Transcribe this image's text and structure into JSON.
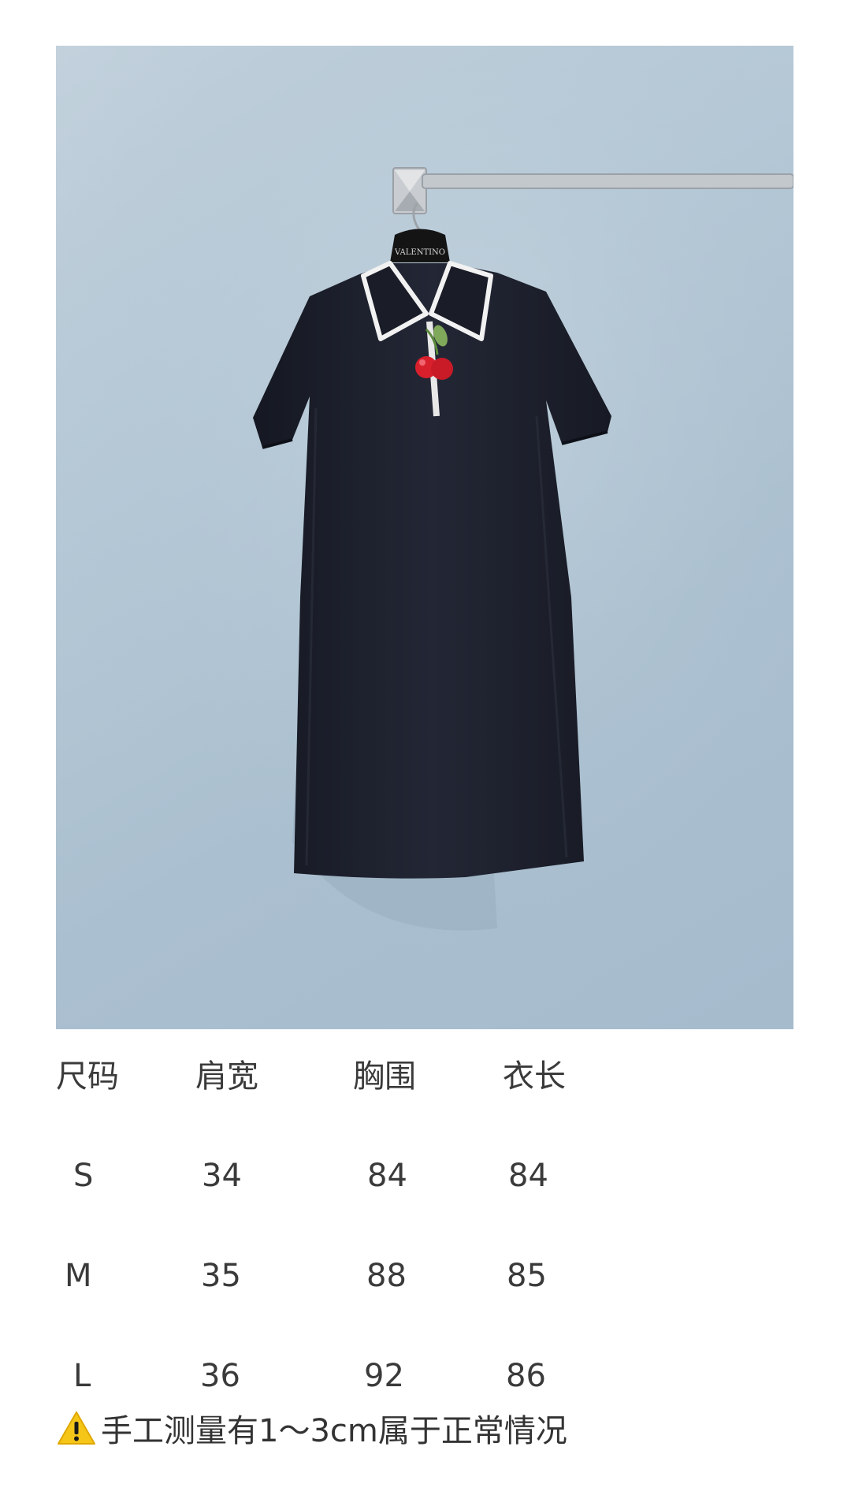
{
  "product_photo": {
    "subject": "dress-on-hanger",
    "hanger_label": "VALENTINO",
    "icon": "product-photo"
  },
  "size_table": {
    "headers": [
      "尺码",
      "肩宽",
      "胸围",
      "衣长"
    ],
    "rows": [
      [
        "S",
        "34",
        "84",
        "84"
      ],
      [
        "M",
        "35",
        "88",
        "85"
      ],
      [
        "L",
        "36",
        "92",
        "86"
      ]
    ]
  },
  "note": {
    "icon": "warning-icon",
    "text": "手工测量有1～3cm属于正常情况"
  },
  "colors": {
    "background": "#ffffff",
    "wall": "#b5c8d6",
    "dress": "#1c1f2b",
    "cherry": "#d8202c",
    "warning": "#f5c518"
  }
}
